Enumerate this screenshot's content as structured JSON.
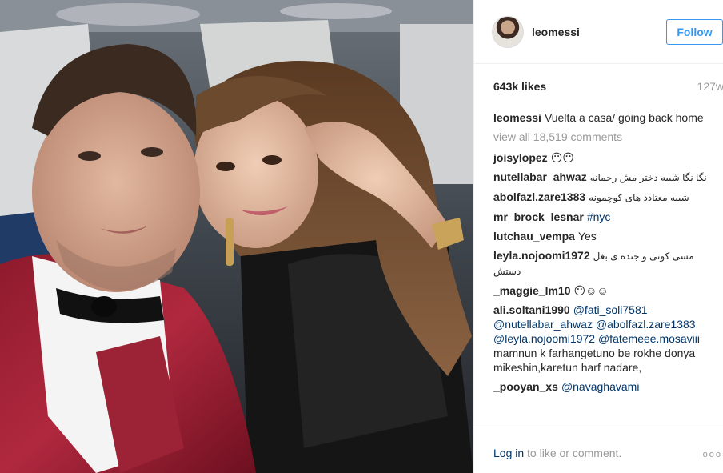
{
  "post": {
    "username": "leomessi",
    "follow_label": "Follow",
    "likes": "643k likes",
    "age": "127w"
  },
  "caption": {
    "user": "leomessi",
    "text": "Vuelta a casa/ going back home"
  },
  "view_all_comments": "view all 18,519 comments",
  "comments": [
    {
      "user": "joisylopez",
      "text": "😶😶"
    },
    {
      "user": "nutellabar_ahwaz",
      "text": "نگا نگا شبیه دختر مش رحمانه"
    },
    {
      "user": "abolfazl.zare1383",
      "text": "شبیه معتادد های کوچمونه"
    },
    {
      "user": "mr_brock_lesnar",
      "mention": "#nyc"
    },
    {
      "user": "lutchau_vempa",
      "text": "Yes"
    },
    {
      "user": "leyla.nojoomi1972",
      "text": "مسی کونی و جنده ی بغل دستش"
    },
    {
      "user": "_maggie_lm10",
      "text": "😶☺☺"
    },
    {
      "user": "ali.soltani1990",
      "mentions": [
        "@fati_soli7581",
        "@nutellabar_ahwaz",
        "@abolfazl.zare1383",
        "@leyla.nojoomi1972",
        "@fatemeee.mosaviii"
      ],
      "text": "mamnun k farhangetuno be rokhe donya mikeshin,karetun harf nadare,"
    },
    {
      "user": "_pooyan_xs",
      "mention": "@navaghavami"
    }
  ],
  "footer": {
    "login": "Log in",
    "rest": " to like or comment.",
    "more": "ooo"
  },
  "icons": {
    "more": "more-options-icon"
  }
}
